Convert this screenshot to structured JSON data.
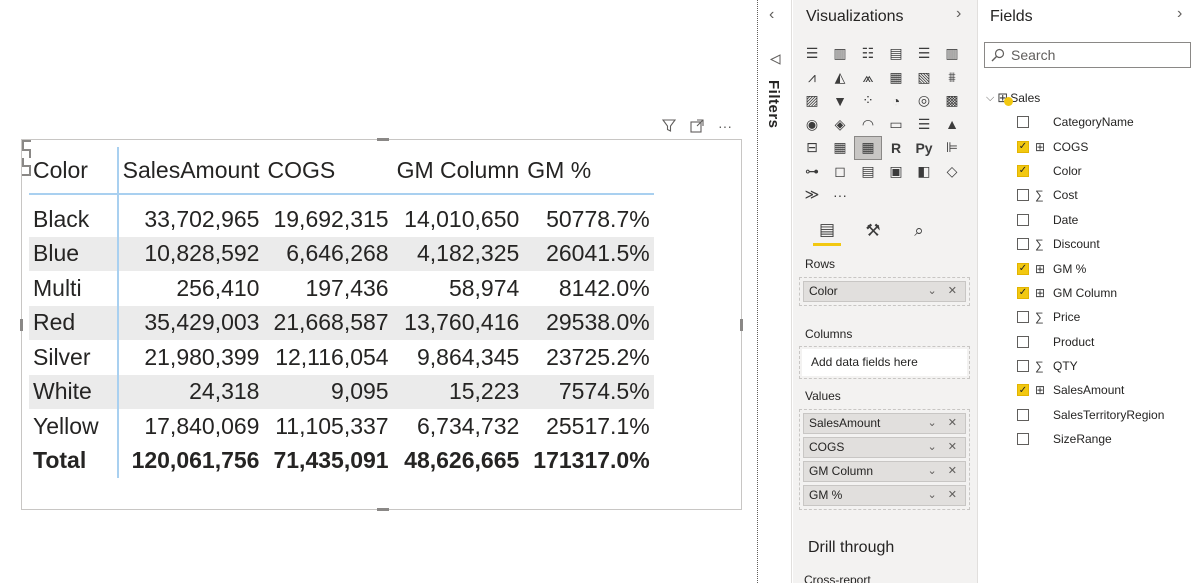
{
  "visual": {
    "header_icons": [
      "filter-icon",
      "focus-mode-icon",
      "more-options-icon"
    ],
    "matrix": {
      "columns": [
        "Color",
        "SalesAmount",
        "COGS",
        "GM Column",
        "GM %"
      ],
      "rows": [
        {
          "label": "Black",
          "values": [
            "33,702,965",
            "19,692,315",
            "14,010,650",
            "50778.7%"
          ]
        },
        {
          "label": "Blue",
          "values": [
            "10,828,592",
            "6,646,268",
            "4,182,325",
            "26041.5%"
          ]
        },
        {
          "label": "Multi",
          "values": [
            "256,410",
            "197,436",
            "58,974",
            "8142.0%"
          ]
        },
        {
          "label": "Red",
          "values": [
            "35,429,003",
            "21,668,587",
            "13,760,416",
            "29538.0%"
          ]
        },
        {
          "label": "Silver",
          "values": [
            "21,980,399",
            "12,116,054",
            "9,864,345",
            "23725.2%"
          ]
        },
        {
          "label": "White",
          "values": [
            "24,318",
            "9,095",
            "15,223",
            "7574.5%"
          ]
        },
        {
          "label": "Yellow",
          "values": [
            "17,840,069",
            "11,105,337",
            "6,734,732",
            "25517.1%"
          ]
        }
      ],
      "total": {
        "label": "Total",
        "values": [
          "120,061,756",
          "71,435,091",
          "48,626,665",
          "171317.0%"
        ]
      }
    }
  },
  "filters_pane": {
    "label": "Filters",
    "chevron": "‹"
  },
  "viz_pane": {
    "title": "Visualizations",
    "chevron": "›",
    "rows_label": "Rows",
    "rows_fields": [
      "Color"
    ],
    "columns_label": "Columns",
    "columns_placeholder": "Add data fields here",
    "values_label": "Values",
    "values_fields": [
      "SalesAmount",
      "COGS",
      "GM Column",
      "GM %"
    ],
    "drill_title": "Drill through",
    "cross_report_label": "Cross-report",
    "chip_controls": "⌄ ✕",
    "icon_r": "R",
    "icon_py": "Py",
    "more": "···"
  },
  "fields_pane": {
    "title": "Fields",
    "chevron": "›",
    "search_placeholder": "Search",
    "table_name": "Sales",
    "fields": [
      {
        "name": "CategoryName",
        "checked": false,
        "icon": ""
      },
      {
        "name": "COGS",
        "checked": true,
        "icon": "measure-table-icon"
      },
      {
        "name": "Color",
        "checked": true,
        "icon": ""
      },
      {
        "name": "Cost",
        "checked": false,
        "icon": "sigma-icon"
      },
      {
        "name": "Date",
        "checked": false,
        "icon": ""
      },
      {
        "name": "Discount",
        "checked": false,
        "icon": "sigma-icon"
      },
      {
        "name": "GM %",
        "checked": true,
        "icon": "measure-table-icon"
      },
      {
        "name": "GM Column",
        "checked": true,
        "icon": "measure-table-icon"
      },
      {
        "name": "Price",
        "checked": false,
        "icon": "sigma-icon"
      },
      {
        "name": "Product",
        "checked": false,
        "icon": ""
      },
      {
        "name": "QTY",
        "checked": false,
        "icon": "sigma-icon"
      },
      {
        "name": "SalesAmount",
        "checked": true,
        "icon": "measure-table-icon"
      },
      {
        "name": "SalesTerritoryRegion",
        "checked": false,
        "icon": ""
      },
      {
        "name": "SizeRange",
        "checked": false,
        "icon": ""
      }
    ]
  },
  "colors": {
    "accent": "#f2c811",
    "grid_line": "#a9d0f0",
    "alt_row": "#ebebeb",
    "pane_bg": "#f3f2f1"
  }
}
